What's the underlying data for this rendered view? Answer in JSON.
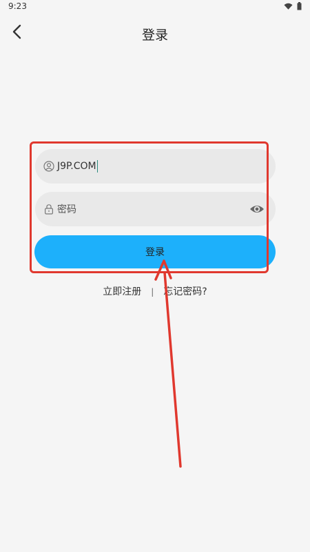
{
  "status_bar": {
    "time": "9:23"
  },
  "header": {
    "title": "登录",
    "back_icon": "chevron-left-icon"
  },
  "form": {
    "username_value": "J9P.COM",
    "username_icon": "user-circle-icon",
    "password_placeholder": "密码",
    "password_icon": "lock-icon",
    "visibility_icon": "eye-icon",
    "submit_label": "登录"
  },
  "links": {
    "register": "立即注册",
    "separator": "|",
    "forgot": "忘记密码?"
  },
  "colors": {
    "accent": "#1db0fb",
    "annotation": "#e0382e",
    "background": "#f5f5f5"
  }
}
